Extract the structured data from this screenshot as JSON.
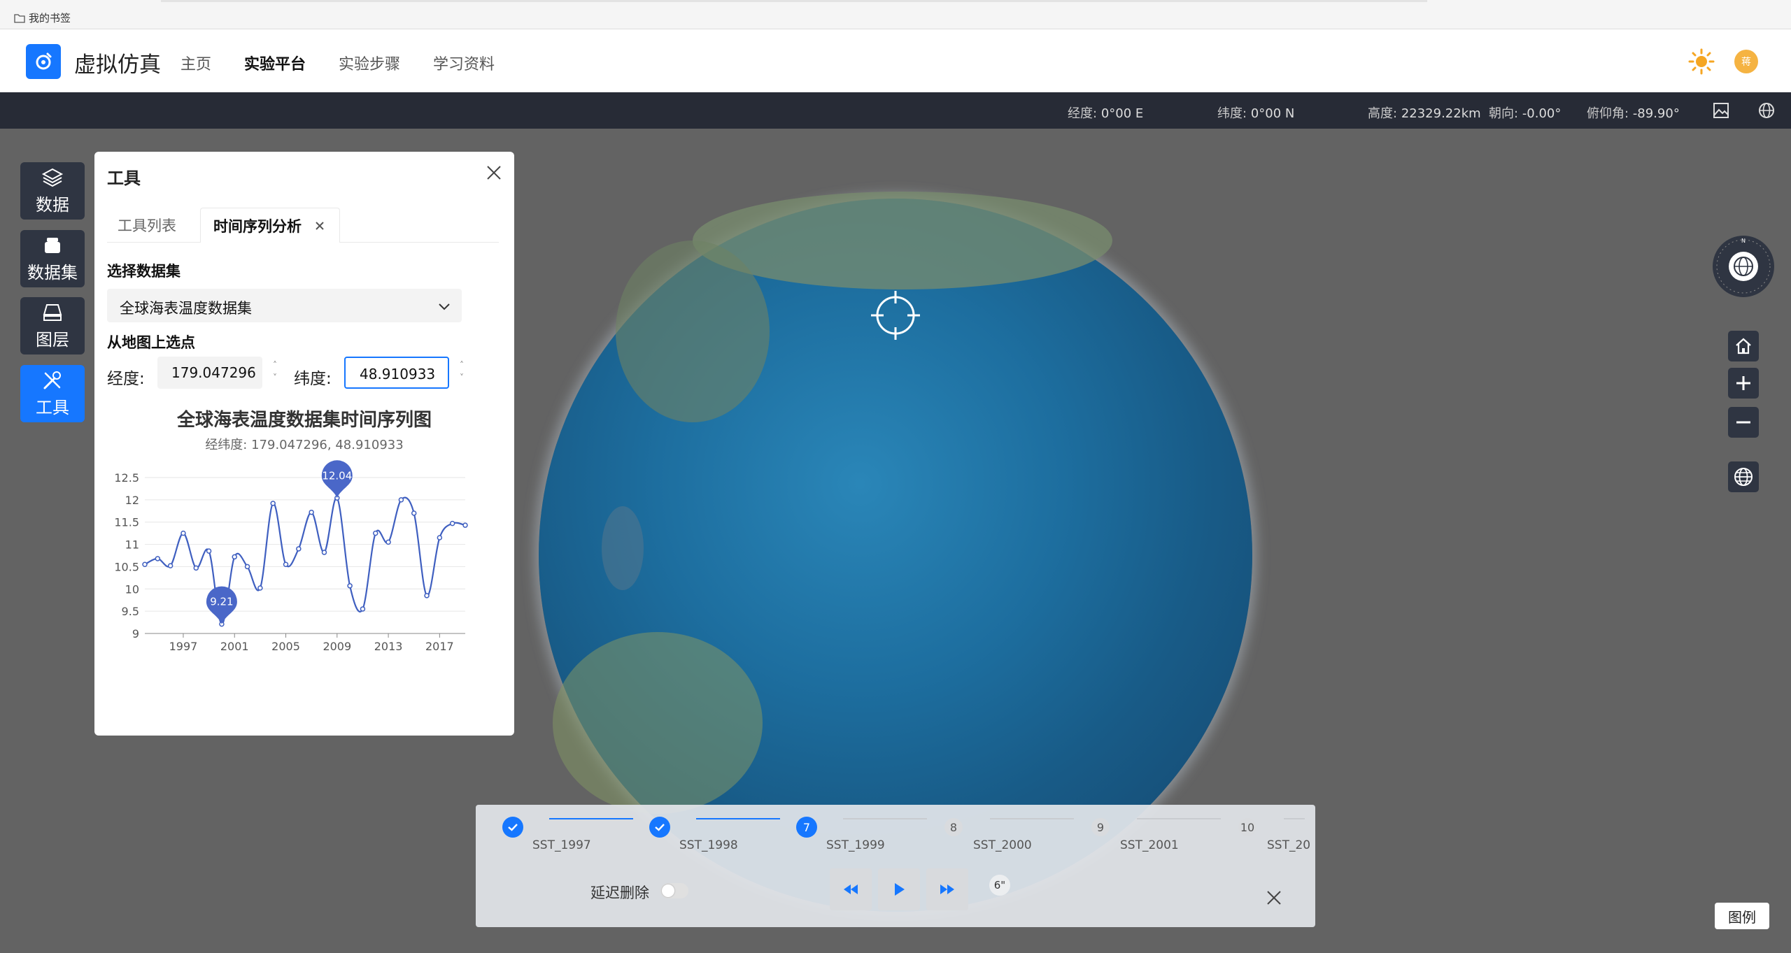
{
  "bookmarks": {
    "folder_label": "我的书签"
  },
  "header": {
    "brand": "虚拟仿真",
    "nav": [
      "主页",
      "实验平台",
      "实验步骤",
      "学习资料"
    ],
    "active_nav": "实验平台",
    "avatar_text": "蒋"
  },
  "status": {
    "lon_label": "经度:",
    "lon_value": "0°00 E",
    "lat_label": "纬度:",
    "lat_value": "0°00 N",
    "alt_label": "高度:",
    "alt_value": "22329.22km",
    "heading_label": "朝向:",
    "heading_value": "-0.00°",
    "pitch_label": "俯仰角:",
    "pitch_value": "-89.90°"
  },
  "sidebar": [
    {
      "label": "数据",
      "icon": "layers-icon"
    },
    {
      "label": "数据集",
      "icon": "dataset-icon"
    },
    {
      "label": "图层",
      "icon": "layer-tray-icon"
    },
    {
      "label": "工具",
      "icon": "tools-icon",
      "active": true
    }
  ],
  "panel": {
    "title": "工具",
    "tabs": [
      "工具列表",
      "时间序列分析"
    ],
    "dataset_label": "选择数据集",
    "dataset_value": "全球海表温度数据集",
    "pick_label": "从地图上选点",
    "lon_label": "经度:",
    "lon_value": "179.047296",
    "lat_label": "纬度:",
    "lat_value": "48.910933"
  },
  "chart_data": {
    "type": "line",
    "title": "全球海表温度数据集时间序列图",
    "subtitle": "经纬度: 179.047296, 48.910933",
    "x": [
      1994,
      1995,
      1996,
      1997,
      1998,
      1999,
      2000,
      2001,
      2002,
      2003,
      2004,
      2005,
      2006,
      2007,
      2008,
      2009,
      2010,
      2011,
      2012,
      2013,
      2014,
      2015,
      2016,
      2017,
      2018,
      2019
    ],
    "values": [
      10.55,
      10.68,
      10.52,
      11.25,
      10.47,
      10.85,
      9.21,
      10.72,
      10.5,
      10.02,
      11.92,
      10.55,
      10.9,
      11.72,
      10.82,
      12.04,
      10.07,
      9.55,
      11.25,
      11.05,
      12.0,
      11.7,
      9.85,
      11.15,
      11.47,
      11.43
    ],
    "xticks": [
      1997,
      2001,
      2005,
      2009,
      2013,
      2017
    ],
    "yticks": [
      9,
      9.5,
      10,
      10.5,
      11,
      11.5,
      12,
      12.5
    ],
    "ylim": [
      9,
      12.5
    ],
    "max_label": "12.04",
    "min_label": "9.21",
    "color": "#3f5fc0"
  },
  "timeline": {
    "steps": [
      {
        "label": "SST_1997",
        "state": "done"
      },
      {
        "label": "SST_1998",
        "state": "done"
      },
      {
        "label": "SST_1999",
        "state": "current",
        "number": "7"
      },
      {
        "label": "SST_2000",
        "state": "wait",
        "number": "8"
      },
      {
        "label": "SST_2001",
        "state": "wait",
        "number": "9"
      },
      {
        "label": "SST_20",
        "state": "wait",
        "number": "10"
      }
    ],
    "delay_label": "延迟删除",
    "speed": "6\""
  },
  "legend_label": "图例",
  "colors": {
    "accent": "#1677ff",
    "dark": "#2f3542",
    "statusbar": "#272b36"
  }
}
